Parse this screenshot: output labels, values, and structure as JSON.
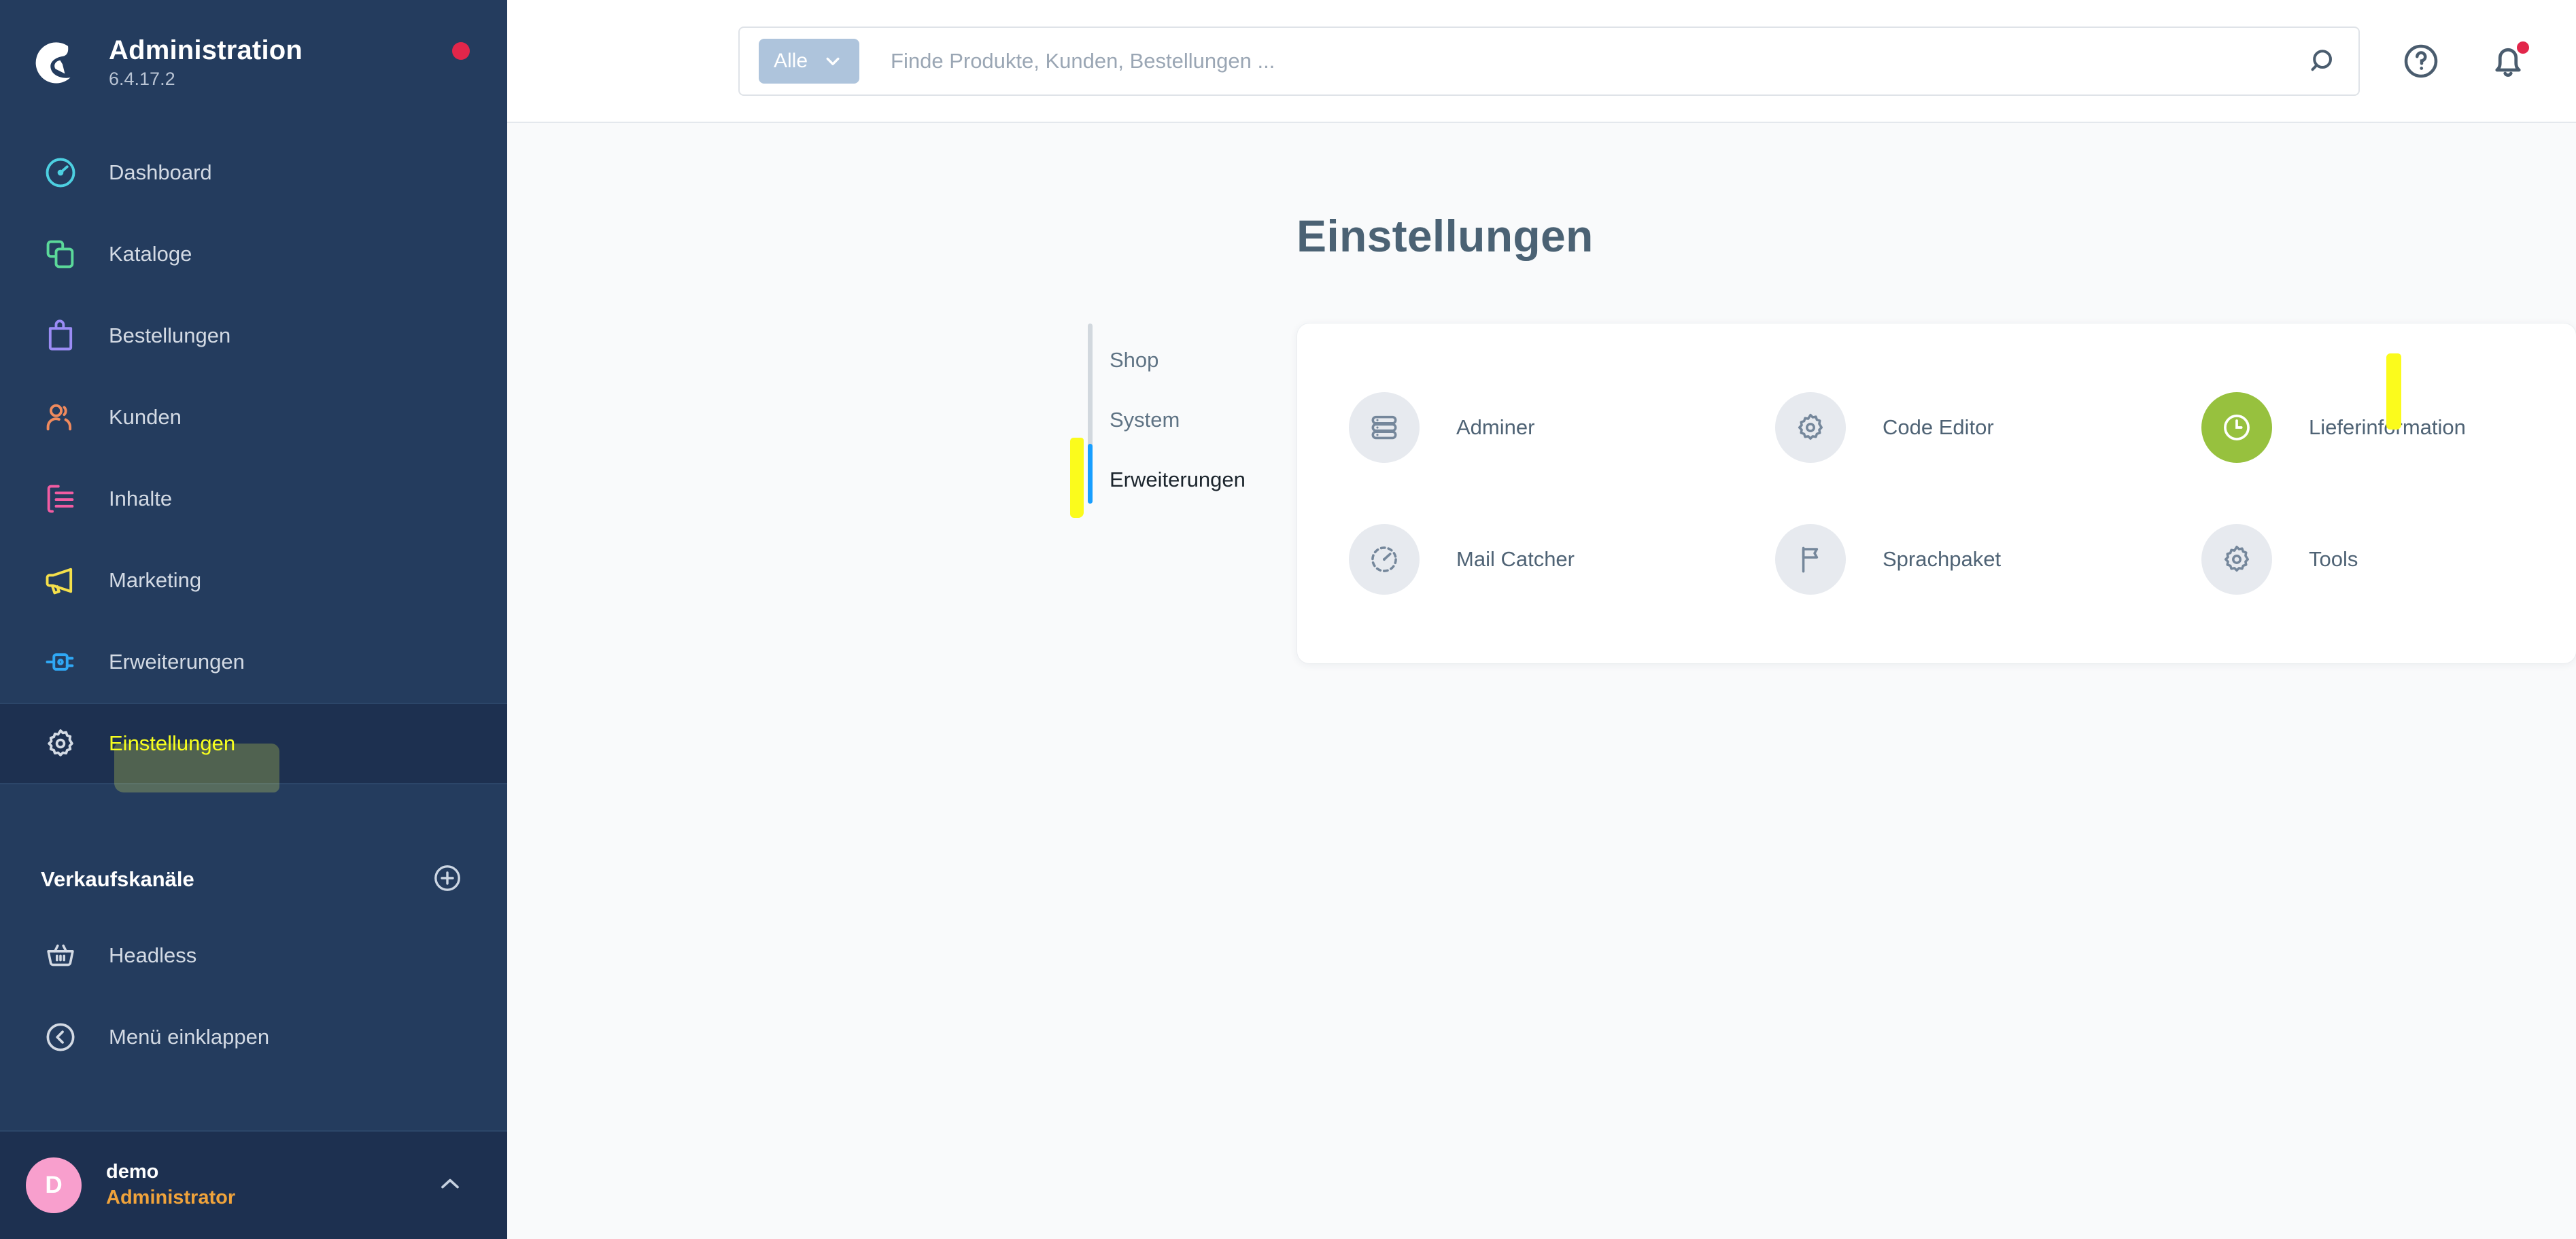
{
  "brand": {
    "title": "Administration",
    "version": "6.4.17.2",
    "logo_icon": "shopware-logo-icon",
    "status_dot_color": "#e2264a"
  },
  "sidebar": {
    "items": [
      {
        "label": "Dashboard",
        "icon": "gauge-icon",
        "color": "#4dd0e1",
        "active": false,
        "highlighted": false
      },
      {
        "label": "Kataloge",
        "icon": "layers-icon",
        "color": "#5bd99a",
        "active": false,
        "highlighted": false
      },
      {
        "label": "Bestellungen",
        "icon": "bag-icon",
        "color": "#9b8cf5",
        "active": false,
        "highlighted": false
      },
      {
        "label": "Kunden",
        "icon": "users-icon",
        "color": "#f08a5d",
        "active": false,
        "highlighted": false
      },
      {
        "label": "Inhalte",
        "icon": "content-icon",
        "color": "#f25ca2",
        "active": false,
        "highlighted": false
      },
      {
        "label": "Marketing",
        "icon": "megaphone-icon",
        "color": "#f5e04b",
        "active": false,
        "highlighted": false
      },
      {
        "label": "Erweiterungen",
        "icon": "plug-icon",
        "color": "#2fa8f5",
        "active": false,
        "highlighted": false
      },
      {
        "label": "Einstellungen",
        "icon": "gear-icon",
        "color": "#d3dae4",
        "active": true,
        "highlighted": true
      }
    ],
    "sales_channels": {
      "heading": "Verkaufskanäle",
      "add_icon": "plus-circle-icon",
      "channels": [
        {
          "label": "Headless",
          "icon": "basket-icon"
        }
      ]
    },
    "collapse": {
      "label": "Menü einklappen",
      "icon": "chevron-left-circle-icon"
    },
    "user": {
      "initial": "D",
      "name": "demo",
      "role": "Administrator",
      "avatar_color": "#f89fcd",
      "role_color": "#f0a33b",
      "chevron_icon": "chevron-up-icon"
    }
  },
  "topbar": {
    "scope": {
      "label": "Alle",
      "caret_icon": "chevron-down-icon"
    },
    "search": {
      "value": "",
      "placeholder": "Finde Produkte, Kunden, Bestellungen ...",
      "submit_icon": "search-icon"
    },
    "actions": [
      {
        "name": "help",
        "icon": "help-circle-icon",
        "badge": false
      },
      {
        "name": "notifications",
        "icon": "bell-icon",
        "badge": true,
        "badge_color": "#e2264a"
      }
    ]
  },
  "main": {
    "page_title": "Einstellungen",
    "tabs": [
      {
        "label": "Shop",
        "active": false
      },
      {
        "label": "System",
        "active": false
      },
      {
        "label": "Erweiterungen",
        "active": true
      }
    ],
    "active_tab_indicator_color": "#189eff",
    "marker_color": "#fbfb1c",
    "cards": [
      {
        "label": "Adminer",
        "icon": "database-icon",
        "accent": false,
        "marked": false
      },
      {
        "label": "Code Editor",
        "icon": "gear-icon",
        "accent": false,
        "marked": false
      },
      {
        "label": "Lieferinformation",
        "icon": "clock-icon",
        "accent": true,
        "marked": true,
        "accent_color": "#97c13e"
      },
      {
        "label": "Mail Catcher",
        "icon": "gauge-icon",
        "accent": false,
        "marked": false
      },
      {
        "label": "Sprachpaket",
        "icon": "flag-icon",
        "accent": false,
        "marked": false
      },
      {
        "label": "Tools",
        "icon": "gear-icon",
        "accent": false,
        "marked": false
      }
    ]
  }
}
